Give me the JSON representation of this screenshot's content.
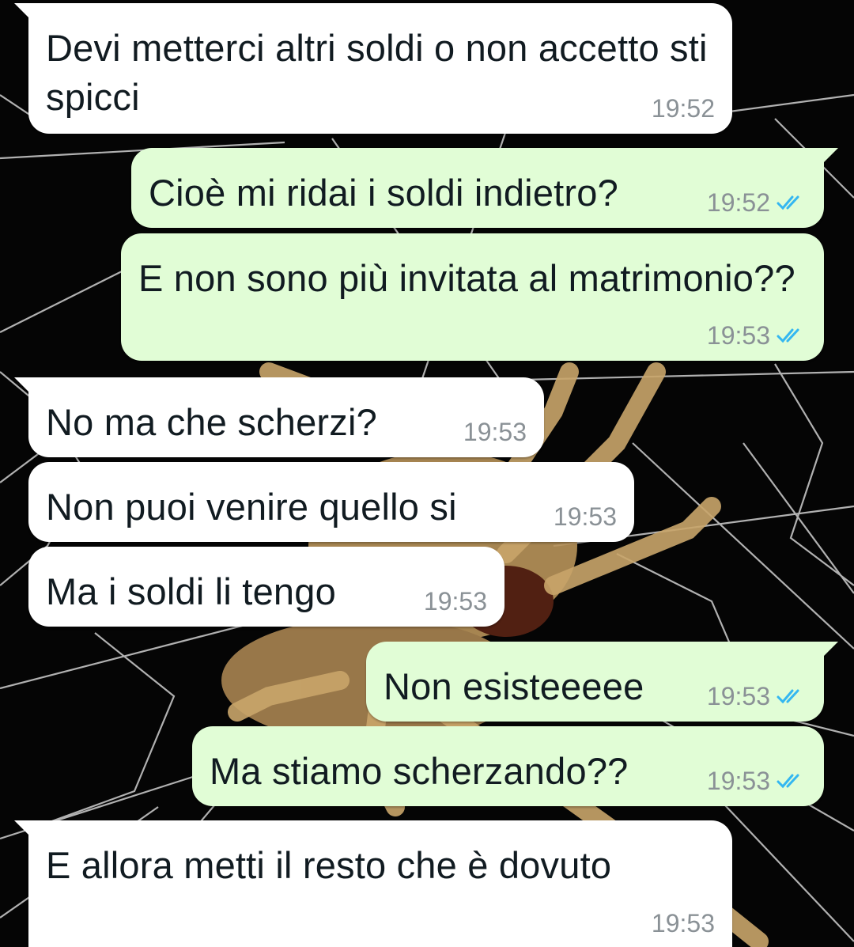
{
  "chat": {
    "messages": [
      {
        "direction": "incoming",
        "text": "Devi metterci altri soldi o non accetto sti spicci",
        "time": "19:52"
      },
      {
        "direction": "outgoing",
        "text": "Cioè mi ridai i soldi indietro?",
        "time": "19:52",
        "status": "read"
      },
      {
        "direction": "outgoing",
        "text": "E non sono più invitata al matrimonio??",
        "time": "19:53",
        "status": "read"
      },
      {
        "direction": "incoming",
        "text": "No ma che scherzi?",
        "time": "19:53"
      },
      {
        "direction": "incoming",
        "text": "Non puoi venire quello si",
        "time": "19:53"
      },
      {
        "direction": "incoming",
        "text": "Ma i soldi li tengo",
        "time": "19:53"
      },
      {
        "direction": "outgoing",
        "text": "Non esisteeeee",
        "time": "19:53",
        "status": "read"
      },
      {
        "direction": "outgoing",
        "text": "Ma stiamo scherzando??",
        "time": "19:53",
        "status": "read"
      },
      {
        "direction": "incoming",
        "text": "E allora metti il resto che è dovuto",
        "time": "19:53"
      }
    ]
  },
  "icons": {
    "read_receipt": "double-check-icon"
  },
  "colors": {
    "incoming_bubble": "#ffffff",
    "outgoing_bubble": "#e1fdd6",
    "read_tick": "#34b7f1",
    "timestamp": "#8a9196",
    "wallpaper": "#050505"
  }
}
